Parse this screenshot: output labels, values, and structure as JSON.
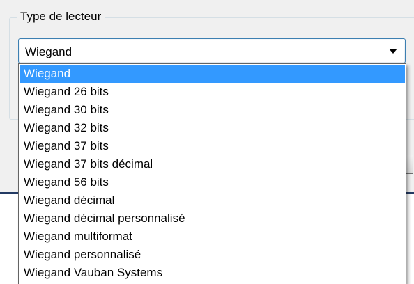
{
  "group": {
    "label": "Type de lecteur"
  },
  "combo": {
    "value": "Wiegand",
    "arrow_icon": "dropdown-arrow-icon"
  },
  "dropdown": {
    "selected_index": 0,
    "options": [
      "Wiegand",
      "Wiegand 26 bits",
      "Wiegand 30 bits",
      "Wiegand 32 bits",
      "Wiegand 37 bits",
      "Wiegand 37 bits décimal",
      "Wiegand 56 bits",
      "Wiegand décimal",
      "Wiegand décimal personnalisé",
      "Wiegand multiformat",
      "Wiegand personnalisé",
      "Wiegand Vauban Systems"
    ]
  },
  "colors": {
    "selection_bg": "#3399ff",
    "selection_text": "#ffffff",
    "combo_border": "#3c7fb1",
    "window_bg": "#f0f0f0"
  }
}
